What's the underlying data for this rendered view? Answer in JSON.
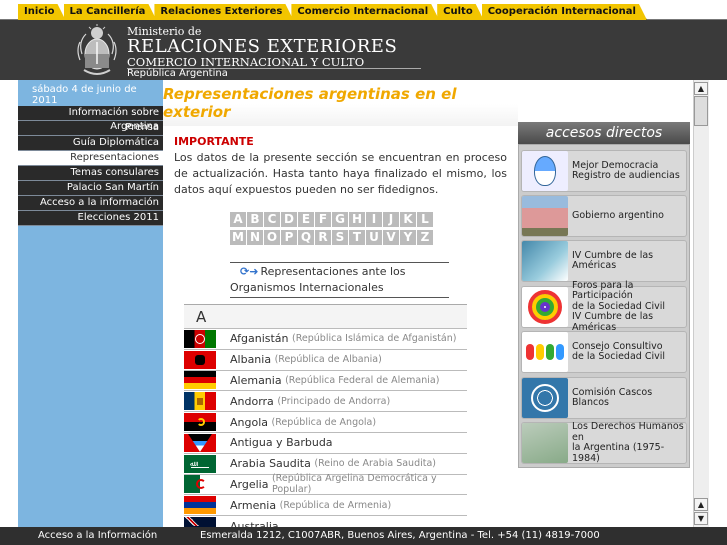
{
  "tabs": [
    "Inicio",
    "La Cancillería",
    "Relaciones Exteriores",
    "Comercio Internacional",
    "Culto",
    "Cooperación Internacional"
  ],
  "header": {
    "ministerio": "Ministerio de",
    "title": "RELACIONES EXTERIORES",
    "subtitle": "COMERCIO INTERNACIONAL Y CULTO",
    "country": "República Argentina"
  },
  "sidebar": {
    "date": "sábado 4 de junio de 2011",
    "items": [
      "Información sobre Argentina",
      "Prensa",
      "Guía Diplomática",
      "Representaciones argentinas",
      "Temas consulares",
      "Palacio San Martín",
      "Acceso a la información",
      "Elecciones 2011"
    ],
    "active_index": 3
  },
  "main": {
    "title": "Representaciones argentinas en el exterior",
    "important_label": "IMPORTANTE",
    "notice": "Los datos de la presente sección se encuentran en proceso de actualización. Hasta tanto haya finalizado el mismo, los datos aquí expuestos pueden no ser fidedignos.",
    "alphabet_row1": [
      "A",
      "B",
      "C",
      "D",
      "E",
      "F",
      "G",
      "H",
      "I",
      "J",
      "K",
      "L"
    ],
    "alphabet_row2": [
      "M",
      "N",
      "O",
      "P",
      "Q",
      "R",
      "S",
      "T",
      "U",
      "V",
      "Y",
      "Z"
    ],
    "org_link": "Representaciones ante los Organismos Internacionales",
    "letter": "A",
    "countries": [
      {
        "name": "Afganistán",
        "full": "(República Islámica de Afganistán)"
      },
      {
        "name": "Albania",
        "full": "(República de Albania)"
      },
      {
        "name": "Alemania",
        "full": "(República Federal de Alemania)"
      },
      {
        "name": "Andorra",
        "full": "(Principado de Andorra)"
      },
      {
        "name": "Angola",
        "full": "(República de Angola)"
      },
      {
        "name": "Antigua y Barbuda",
        "full": ""
      },
      {
        "name": "Arabia Saudita",
        "full": "(Reino de Arabia Saudita)"
      },
      {
        "name": "Argelia",
        "full": "(República Argelina Democrática y Popular)"
      },
      {
        "name": "Armenia",
        "full": "(República de Armenia)"
      },
      {
        "name": "Australia",
        "full": ""
      }
    ]
  },
  "accesos": {
    "title": "accesos directos",
    "items": [
      {
        "line1": "Mejor Democracia",
        "line2": "Registro de audiencias",
        "line3": ""
      },
      {
        "line1": "Gobierno argentino",
        "line2": "",
        "line3": ""
      },
      {
        "line1": "IV Cumbre de las Américas",
        "line2": "",
        "line3": ""
      },
      {
        "line1": "Foros para la Participación",
        "line2": "de la Sociedad Civil",
        "line3": "IV Cumbre de las Américas"
      },
      {
        "line1": "Consejo Consultivo",
        "line2": "de la Sociedad Civil",
        "line3": ""
      },
      {
        "line1": "Comisión Cascos Blancos",
        "line2": "",
        "line3": ""
      },
      {
        "line1": "Los Derechos Humanos en",
        "line2": "la Argentina (1975-1984)",
        "line3": ""
      }
    ]
  },
  "footer": {
    "left": "Acceso a la Información",
    "address": "Esmeralda 1212, C1007ABR, Buenos Aires, Argentina - Tel. +54 (11) 4819-7000"
  },
  "colors": {
    "tab": "#f2c500",
    "sidebar": "#7db5e0",
    "title": "#f0a800",
    "important": "#cc0000"
  }
}
